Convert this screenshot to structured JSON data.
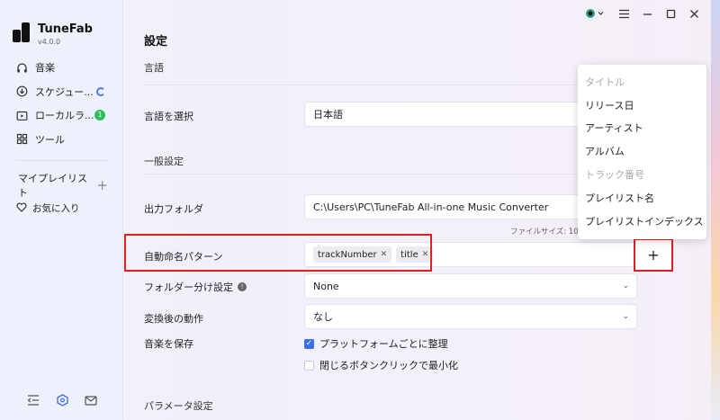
{
  "app": {
    "name": "TuneFab",
    "version": "v4.0.0"
  },
  "sidebar": {
    "items": [
      {
        "label": "音楽",
        "icon": "headphones-icon"
      },
      {
        "label": "スケジュー...",
        "icon": "download-icon"
      },
      {
        "label": "ローカルラ...",
        "icon": "local-library-icon",
        "badge": "1"
      },
      {
        "label": "ツール",
        "icon": "grid-icon"
      }
    ],
    "playlist_label": "マイプレイリスト",
    "favorites_label": "お気に入り"
  },
  "main": {
    "title": "設定",
    "section_language": "言語",
    "language_label": "言語を選択",
    "language_value": "日本語",
    "section_general": "一般設定",
    "output_folder_label": "出力フォルダ",
    "output_folder_value": "C:\\Users\\PC\\TuneFab All-in-one Music Converter",
    "file_size_text": "ファイルサイズ: 1018",
    "naming_label": "自動命名パターン",
    "naming_tags": [
      "trackNumber",
      "title"
    ],
    "folder_split_label": "フォルダー分け設定",
    "folder_split_value": "None",
    "after_convert_label": "変換後の動作",
    "after_convert_value": "なし",
    "save_music_label": "音楽を保存",
    "organize_by_platform": "プラットフォームごとに整理",
    "minimize_on_close": "閉じるボタンクリックで最小化",
    "section_params": "パラメータ設定",
    "add_button": "+"
  },
  "dropdown": {
    "items": [
      {
        "label": "タイトル",
        "disabled": true
      },
      {
        "label": "リリース日",
        "disabled": false
      },
      {
        "label": "アーティスト",
        "disabled": false
      },
      {
        "label": "アルバム",
        "disabled": false
      },
      {
        "label": "トラック番号",
        "disabled": true
      },
      {
        "label": "プレイリスト名",
        "disabled": false
      },
      {
        "label": "プレイリストインデックス",
        "disabled": false
      }
    ]
  },
  "colors": {
    "accent": "#3b6ee8",
    "highlight": "#e02020",
    "badge_green": "#2fbf5a"
  }
}
